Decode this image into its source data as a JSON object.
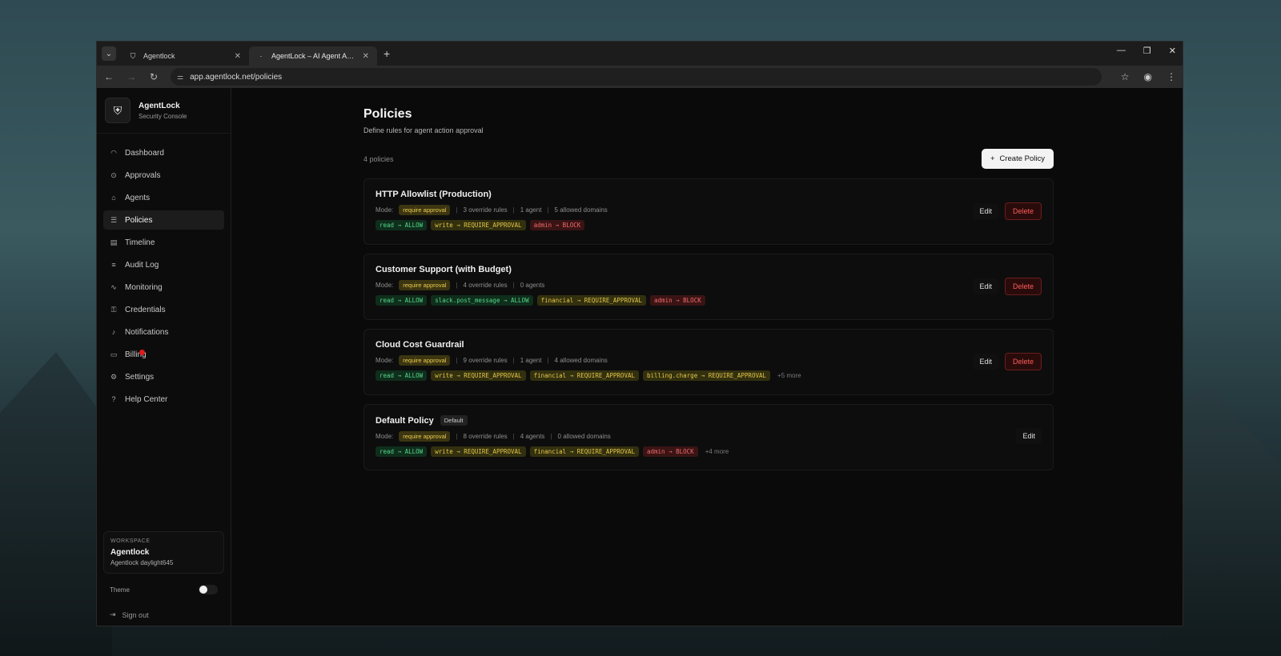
{
  "browser": {
    "tabs": [
      {
        "title": "Agentlock",
        "active": false
      },
      {
        "title": "AgentLock – AI Agent Approval",
        "active": true
      }
    ],
    "url": "app.agentlock.net/policies"
  },
  "brand": {
    "name": "AgentLock",
    "subtitle": "Security Console"
  },
  "sidebar": {
    "items": [
      {
        "label": "Dashboard",
        "icon": "dashboard-icon",
        "glyph": "◠"
      },
      {
        "label": "Approvals",
        "icon": "check-circle-icon",
        "glyph": "⊙"
      },
      {
        "label": "Agents",
        "icon": "robot-icon",
        "glyph": "⌂"
      },
      {
        "label": "Policies",
        "icon": "sliders-icon",
        "glyph": "☰",
        "active": true
      },
      {
        "label": "Timeline",
        "icon": "timeline-icon",
        "glyph": "▤"
      },
      {
        "label": "Audit Log",
        "icon": "list-icon",
        "glyph": "≡"
      },
      {
        "label": "Monitoring",
        "icon": "activity-icon",
        "glyph": "∿"
      },
      {
        "label": "Credentials",
        "icon": "key-icon",
        "glyph": "⚿"
      },
      {
        "label": "Notifications",
        "icon": "bell-icon",
        "glyph": "♪"
      },
      {
        "label": "Billing",
        "icon": "credit-card-icon",
        "glyph": "▭"
      },
      {
        "label": "Settings",
        "icon": "gear-icon",
        "glyph": "⚙"
      },
      {
        "label": "Help Center",
        "icon": "help-icon",
        "glyph": "?"
      }
    ],
    "workspace": {
      "label": "WORKSPACE",
      "name": "Agentlock",
      "sub": "Agentlock daylight645"
    },
    "theme_label": "Theme",
    "signout_label": "Sign out"
  },
  "main": {
    "title": "Policies",
    "subtitle": "Define rules for agent action approval",
    "count": "4 policies",
    "create_label": "Create Policy",
    "edit_label": "Edit",
    "delete_label": "Delete",
    "mode_label": "Mode:",
    "policies": [
      {
        "name": "HTTP Allowlist (Production)",
        "mode": "require approval",
        "meta": [
          "3 override rules",
          "1 agent",
          "5 allowed domains"
        ],
        "chips": [
          {
            "text": "read → ALLOW",
            "kind": "allow"
          },
          {
            "text": "write → REQUIRE_APPROVAL",
            "kind": "approval"
          },
          {
            "text": "admin → BLOCK",
            "kind": "block"
          }
        ],
        "more": "",
        "deletable": true
      },
      {
        "name": "Customer Support (with Budget)",
        "mode": "require approval",
        "meta": [
          "4 override rules",
          "0 agents"
        ],
        "chips": [
          {
            "text": "read → ALLOW",
            "kind": "allow"
          },
          {
            "text": "slack.post_message → ALLOW",
            "kind": "allow"
          },
          {
            "text": "financial → REQUIRE_APPROVAL",
            "kind": "approval"
          },
          {
            "text": "admin → BLOCK",
            "kind": "block"
          }
        ],
        "more": "",
        "deletable": true
      },
      {
        "name": "Cloud Cost Guardrail",
        "mode": "require approval",
        "meta": [
          "9 override rules",
          "1 agent",
          "4 allowed domains"
        ],
        "chips": [
          {
            "text": "read → ALLOW",
            "kind": "allow"
          },
          {
            "text": "write → REQUIRE_APPROVAL",
            "kind": "approval"
          },
          {
            "text": "financial → REQUIRE_APPROVAL",
            "kind": "approval"
          },
          {
            "text": "billing.charge → REQUIRE_APPROVAL",
            "kind": "approval"
          }
        ],
        "more": "+5 more",
        "deletable": true
      },
      {
        "name": "Default Policy",
        "badge": "Default",
        "mode": "require approval",
        "meta": [
          "8 override rules",
          "4 agents",
          "0 allowed domains"
        ],
        "chips": [
          {
            "text": "read → ALLOW",
            "kind": "allow"
          },
          {
            "text": "write → REQUIRE_APPROVAL",
            "kind": "approval"
          },
          {
            "text": "financial → REQUIRE_APPROVAL",
            "kind": "approval"
          },
          {
            "text": "admin → BLOCK",
            "kind": "block"
          }
        ],
        "more": "+4 more",
        "deletable": false
      }
    ]
  }
}
